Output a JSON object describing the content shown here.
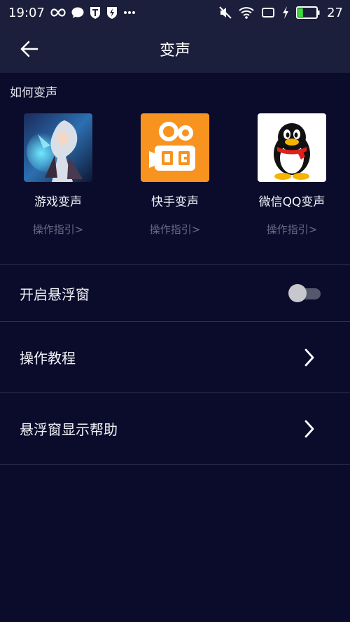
{
  "status_bar": {
    "time": "19:07",
    "battery_level": "27",
    "battery_fraction": 0.27,
    "left_icons": [
      "infinity-icon",
      "chat-bubble-icon",
      "shield-t-icon",
      "shield-lightning-icon",
      "more-dots-icon"
    ],
    "right_icons": [
      "mute-icon",
      "wifi-icon",
      "screen-icon",
      "charging-icon",
      "battery-icon"
    ]
  },
  "header": {
    "title": "变声",
    "back_icon": "back-arrow-icon"
  },
  "section": {
    "title": "如何变声",
    "items": [
      {
        "label": "游戏变声",
        "guide": "操作指引>",
        "image": "game-character-artwork"
      },
      {
        "label": "快手变声",
        "guide": "操作指引>",
        "image": "kuaishou-logo"
      },
      {
        "label": "微信QQ变声",
        "guide": "操作指引>",
        "image": "qq-penguin-logo"
      }
    ]
  },
  "settings": {
    "float_window": {
      "label": "开启悬浮窗",
      "enabled": false
    },
    "tutorial": {
      "label": "操作教程"
    },
    "float_help": {
      "label": "悬浮窗显示帮助"
    }
  },
  "colors": {
    "background": "#0b0b2b",
    "header": "#1c1f3b",
    "divider": "#2e3150",
    "muted_text": "#6a6c85",
    "kuaishou_orange": "#f7931e",
    "battery_green": "#3ddc3d"
  }
}
